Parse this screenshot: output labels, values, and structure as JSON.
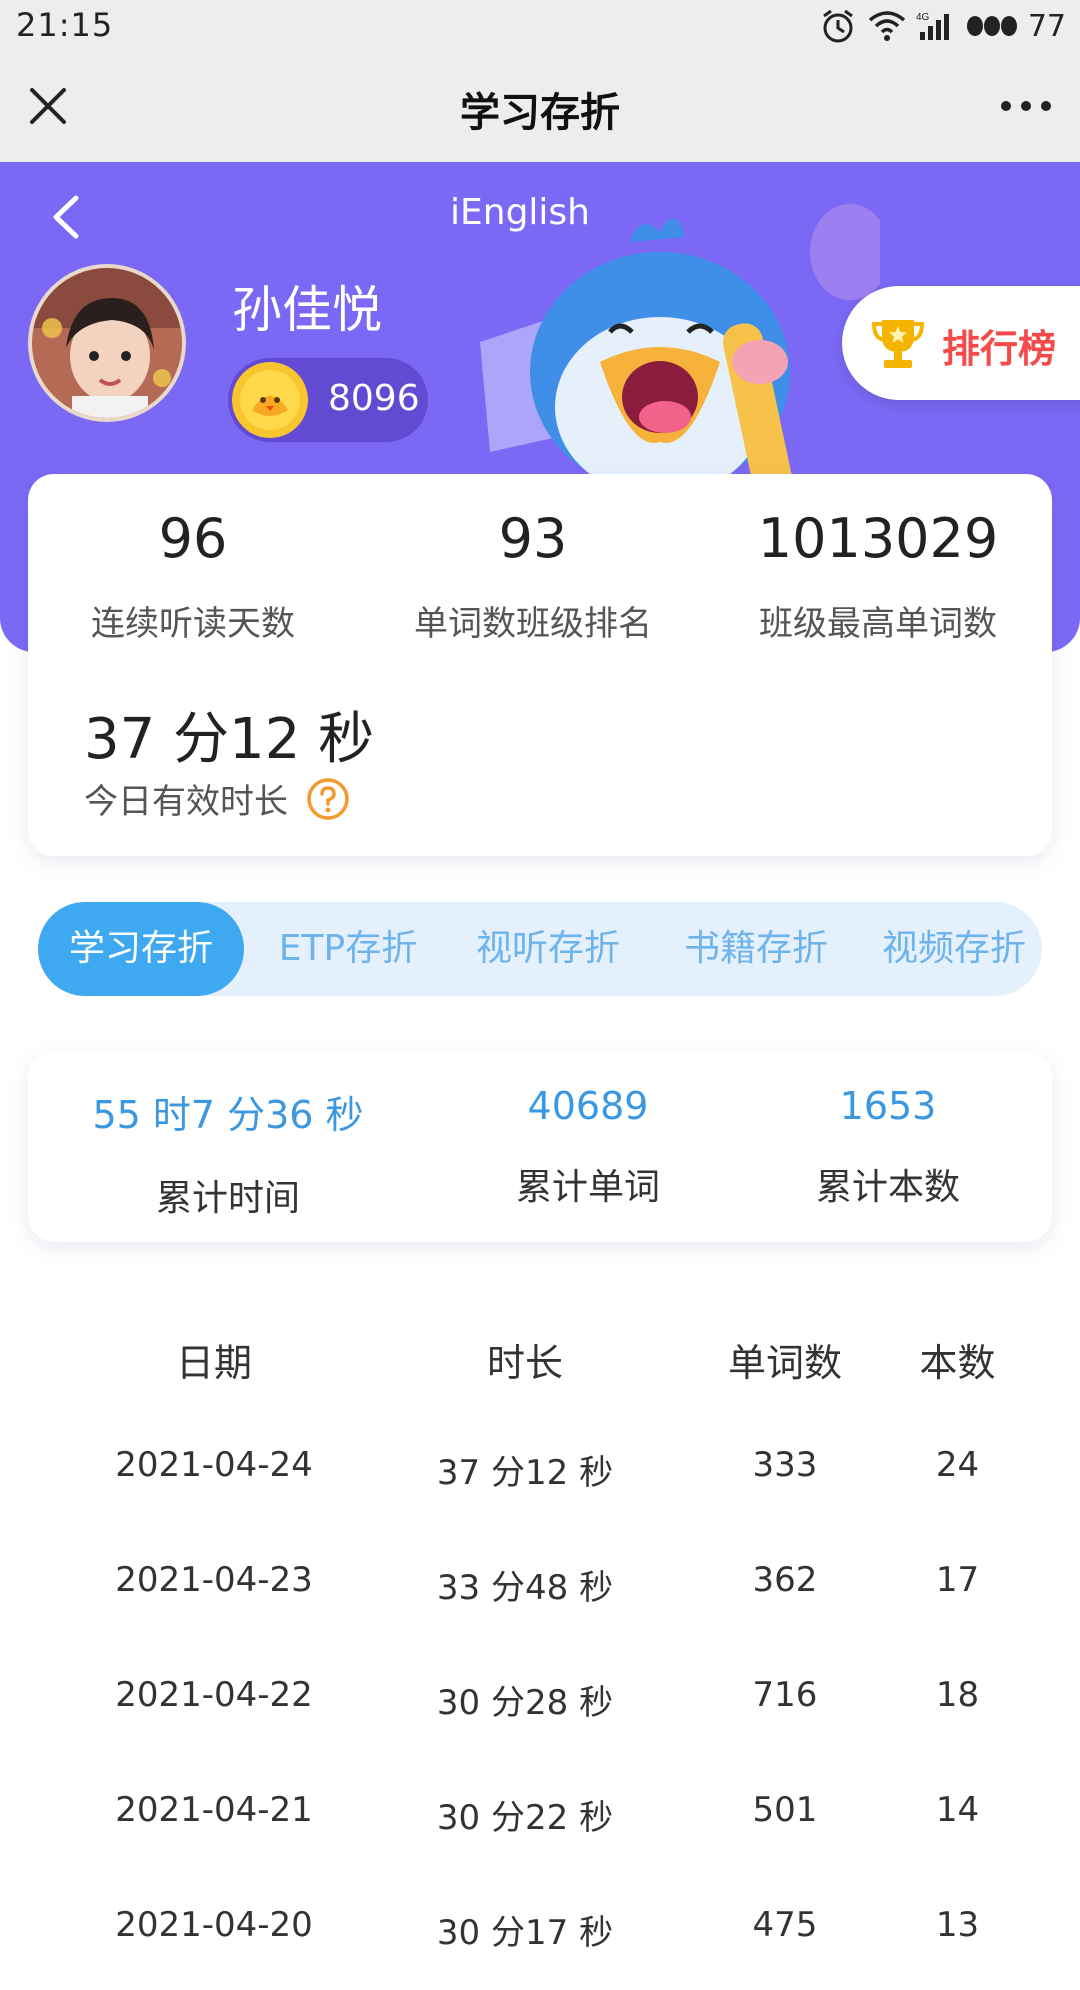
{
  "status_bar": {
    "time": "21:15",
    "battery": "77"
  },
  "nav": {
    "title": "学习存折"
  },
  "banner": {
    "app_name": "iEnglish"
  },
  "user": {
    "name": "孙佳悦",
    "coins": "8096"
  },
  "rank_button": {
    "label": "排行榜"
  },
  "stats": [
    {
      "value": "96",
      "label": "连续听读天数"
    },
    {
      "value": "93",
      "label": "单词数班级排名"
    },
    {
      "value": "1013029",
      "label": "班级最高单词数"
    }
  ],
  "today": {
    "value": "37 分12 秒",
    "label": "今日有效时长"
  },
  "tabs": [
    {
      "label": "学习存折",
      "active": true
    },
    {
      "label": "ETP存折",
      "active": false
    },
    {
      "label": "视听存折",
      "active": false
    },
    {
      "label": "书籍存折",
      "active": false
    },
    {
      "label": "视频存折",
      "active": false
    }
  ],
  "totals": [
    {
      "value": "55 时7 分36 秒",
      "label": "累计时间"
    },
    {
      "value": "40689",
      "label": "累计单词"
    },
    {
      "value": "1653",
      "label": "累计本数"
    }
  ],
  "table": {
    "headers": [
      "日期",
      "时长",
      "单词数",
      "本数"
    ],
    "rows": [
      [
        "2021-04-24",
        "37 分12 秒",
        "333",
        "24"
      ],
      [
        "2021-04-23",
        "33 分48 秒",
        "362",
        "17"
      ],
      [
        "2021-04-22",
        "30 分28 秒",
        "716",
        "18"
      ],
      [
        "2021-04-21",
        "30 分22 秒",
        "501",
        "14"
      ],
      [
        "2021-04-20",
        "30 分17 秒",
        "475",
        "13"
      ]
    ]
  },
  "colors": {
    "banner": "#7b68f5",
    "tab_active": "#3ea9f1",
    "accent_blue": "#3b98e0",
    "rank_red": "#f44a4a"
  }
}
